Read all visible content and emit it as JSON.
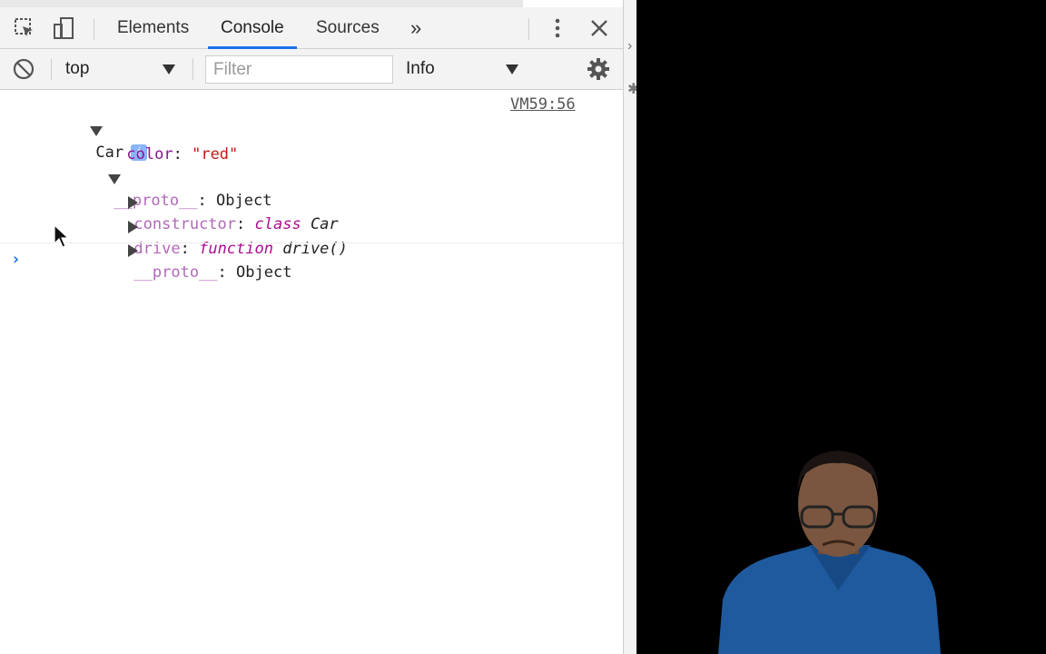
{
  "toolbar": {
    "tabs": [
      {
        "label": "Elements"
      },
      {
        "label": "Console",
        "active": true
      },
      {
        "label": "Sources"
      }
    ],
    "more_tabs_glyph": "»",
    "icons": [
      "inspect-element-icon",
      "device-toolbar-icon",
      "more-vert-icon",
      "close-icon"
    ],
    "accent_color": "#1a73e8"
  },
  "console_toolbar": {
    "context": "top",
    "filter_placeholder": "Filter",
    "level": "Info"
  },
  "output": {
    "source_link": "VM59:56",
    "root": {
      "label": "Car"
    },
    "color_key": "color",
    "color_value": "\"red\"",
    "proto_key": "__proto__",
    "proto_value": "Object",
    "children": [
      {
        "key": "constructor",
        "kw": "class",
        "name": "Car"
      },
      {
        "key": "drive",
        "kw": "function",
        "name": "drive()"
      },
      {
        "key": "__proto__",
        "value": "Object"
      }
    ],
    "prompt": "›"
  }
}
